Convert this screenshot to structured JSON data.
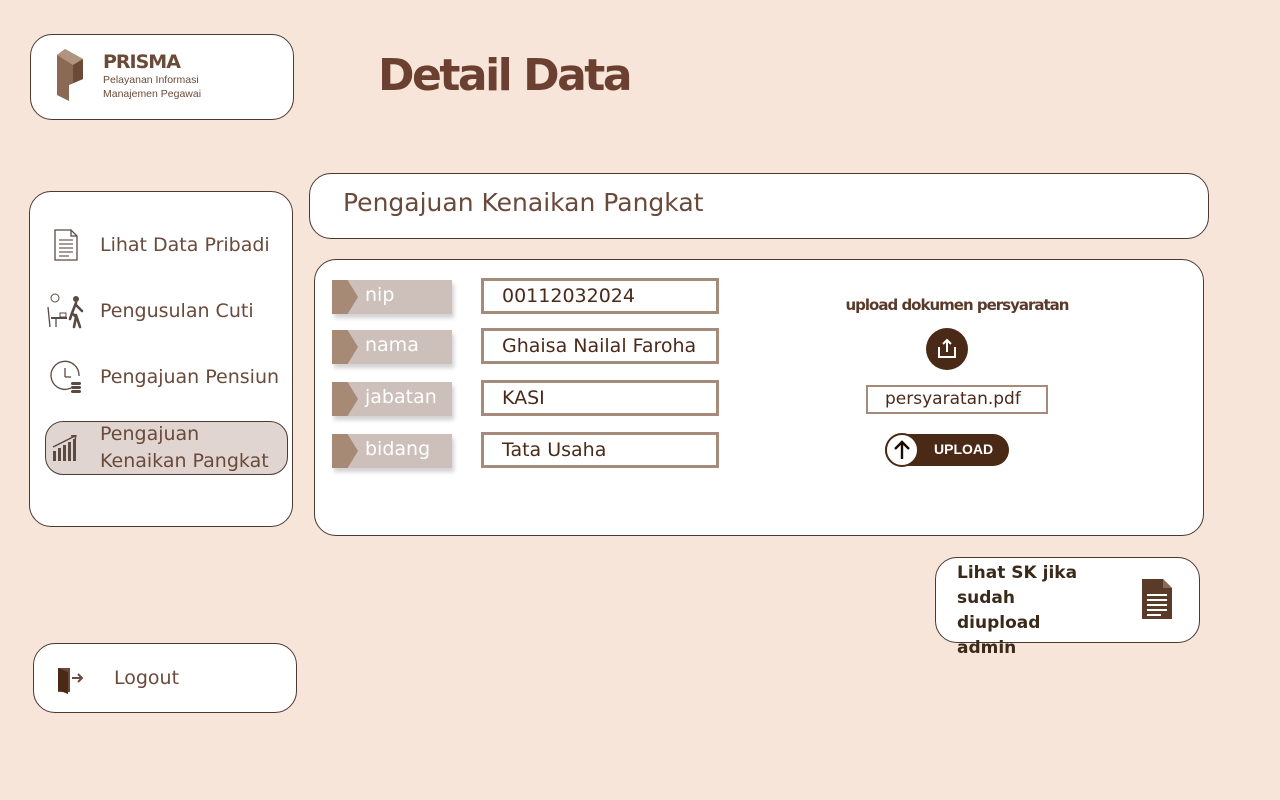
{
  "brand": {
    "name": "PRISMA",
    "tagline": "Pelayanan Informasi Manajemen Pegawai"
  },
  "page": {
    "title": "Detail Data"
  },
  "sidebar": {
    "items": [
      {
        "label": "Lihat Data Pribadi",
        "icon": "document-icon",
        "active": false
      },
      {
        "label": "Pengusulan Cuti",
        "icon": "leave-walk-icon",
        "active": false
      },
      {
        "label": "Pengajuan Pensiun",
        "icon": "clock-coins-icon",
        "active": false
      },
      {
        "label": "Pengajuan Kenaikan Pangkat",
        "icon": "growth-chart-icon",
        "active": true
      }
    ]
  },
  "logout": {
    "label": "Logout",
    "icon": "door-exit-icon"
  },
  "header": {
    "title": "Pengajuan Kenaikan Pangkat"
  },
  "form": {
    "fields": [
      {
        "label": "nip",
        "value": "00112032024"
      },
      {
        "label": "nama",
        "value": "Ghaisa Nailal Faroha"
      },
      {
        "label": "jabatan",
        "value": "KASI"
      },
      {
        "label": "bidang",
        "value": "Tata Usaha"
      }
    ]
  },
  "upload": {
    "title": "upload dokumen persyaratan",
    "filename": "persyaratan.pdf",
    "button_label": "UPLOAD"
  },
  "sk": {
    "label": "Lihat SK jika sudah diupload admin",
    "icon": "file-icon"
  },
  "colors": {
    "background": "#f8e5d9",
    "accent_dark": "#4a2a16",
    "tag_bg": "#cdbfba",
    "tag_arrow": "#a68a75",
    "field_border": "#a48b7a",
    "active_nav": "#e0d5d0"
  }
}
